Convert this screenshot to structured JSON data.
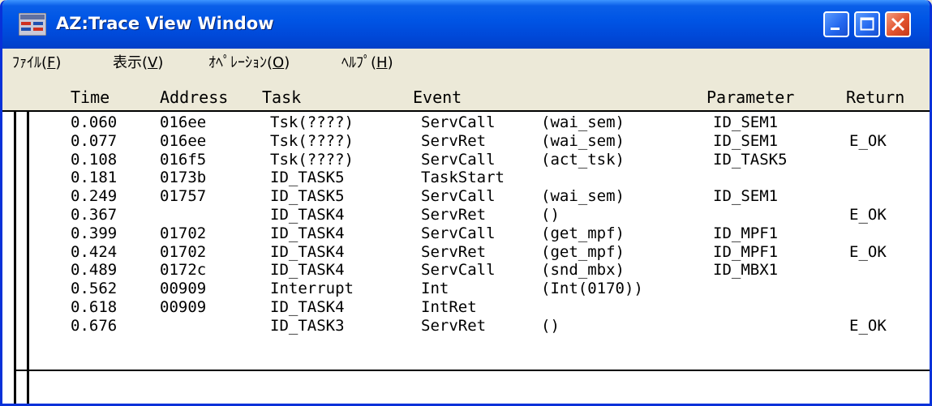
{
  "window": {
    "title": "AZ:Trace View Window"
  },
  "menu": [
    {
      "label": "ﾌｧｲﾙ(",
      "key": "F",
      "suffix": ")"
    },
    {
      "label": "表示(",
      "key": "V",
      "suffix": ")"
    },
    {
      "label": "ｵﾍﾟﾚｰｼｮﾝ(",
      "key": "O",
      "suffix": ")"
    },
    {
      "label": "ﾍﾙﾌﾟ(",
      "key": "H",
      "suffix": ")"
    }
  ],
  "columns": {
    "time": "Time",
    "address": "Address",
    "task": "Task",
    "event": "Event",
    "parameter": "Parameter",
    "return": "Return"
  },
  "rows": [
    {
      "time": "0.060",
      "address": "016ee",
      "task": "Tsk(????)",
      "event": "ServCall",
      "arg": "(wai_sem)",
      "param": "ID_SEM1",
      "ret": ""
    },
    {
      "time": "0.077",
      "address": "016ee",
      "task": "Tsk(????)",
      "event": "ServRet",
      "arg": "(wai_sem)",
      "param": "ID_SEM1",
      "ret": "E_OK"
    },
    {
      "time": "0.108",
      "address": "016f5",
      "task": "Tsk(????)",
      "event": "ServCall",
      "arg": "(act_tsk)",
      "param": "ID_TASK5",
      "ret": ""
    },
    {
      "time": "0.181",
      "address": "0173b",
      "task": "ID_TASK5",
      "event": "TaskStart",
      "arg": "",
      "param": "",
      "ret": ""
    },
    {
      "time": "0.249",
      "address": "01757",
      "task": "ID_TASK5",
      "event": "ServCall",
      "arg": "(wai_sem)",
      "param": "ID_SEM1",
      "ret": ""
    },
    {
      "time": "0.367",
      "address": "",
      "task": "ID_TASK4",
      "event": "ServRet",
      "arg": "()",
      "param": "",
      "ret": "E_OK"
    },
    {
      "time": "0.399",
      "address": "01702",
      "task": "ID_TASK4",
      "event": "ServCall",
      "arg": "(get_mpf)",
      "param": "ID_MPF1",
      "ret": ""
    },
    {
      "time": "0.424",
      "address": "01702",
      "task": "ID_TASK4",
      "event": "ServRet",
      "arg": "(get_mpf)",
      "param": "ID_MPF1",
      "ret": "E_OK"
    },
    {
      "time": "0.489",
      "address": "0172c",
      "task": "ID_TASK4",
      "event": "ServCall",
      "arg": "(snd_mbx)",
      "param": "ID_MBX1",
      "ret": ""
    },
    {
      "time": "0.562",
      "address": "00909",
      "task": "Interrupt",
      "event": "Int",
      "arg": "(Int(0170))",
      "param": "",
      "ret": ""
    },
    {
      "time": "0.618",
      "address": "00909",
      "task": "ID_TASK4",
      "event": "IntRet",
      "arg": "",
      "param": "",
      "ret": ""
    },
    {
      "time": "0.676",
      "address": "",
      "task": "ID_TASK3",
      "event": "ServRet",
      "arg": "()",
      "param": "",
      "ret": "E_OK"
    }
  ],
  "colors": {
    "titlebar": "#0055E5",
    "frame": "#0831D9",
    "close": "#E2532E",
    "face": "#ECE9D8"
  },
  "icons": {
    "app": "trace-app-icon",
    "minimize": "minimize-icon",
    "maximize": "maximize-icon",
    "close": "close-icon"
  }
}
